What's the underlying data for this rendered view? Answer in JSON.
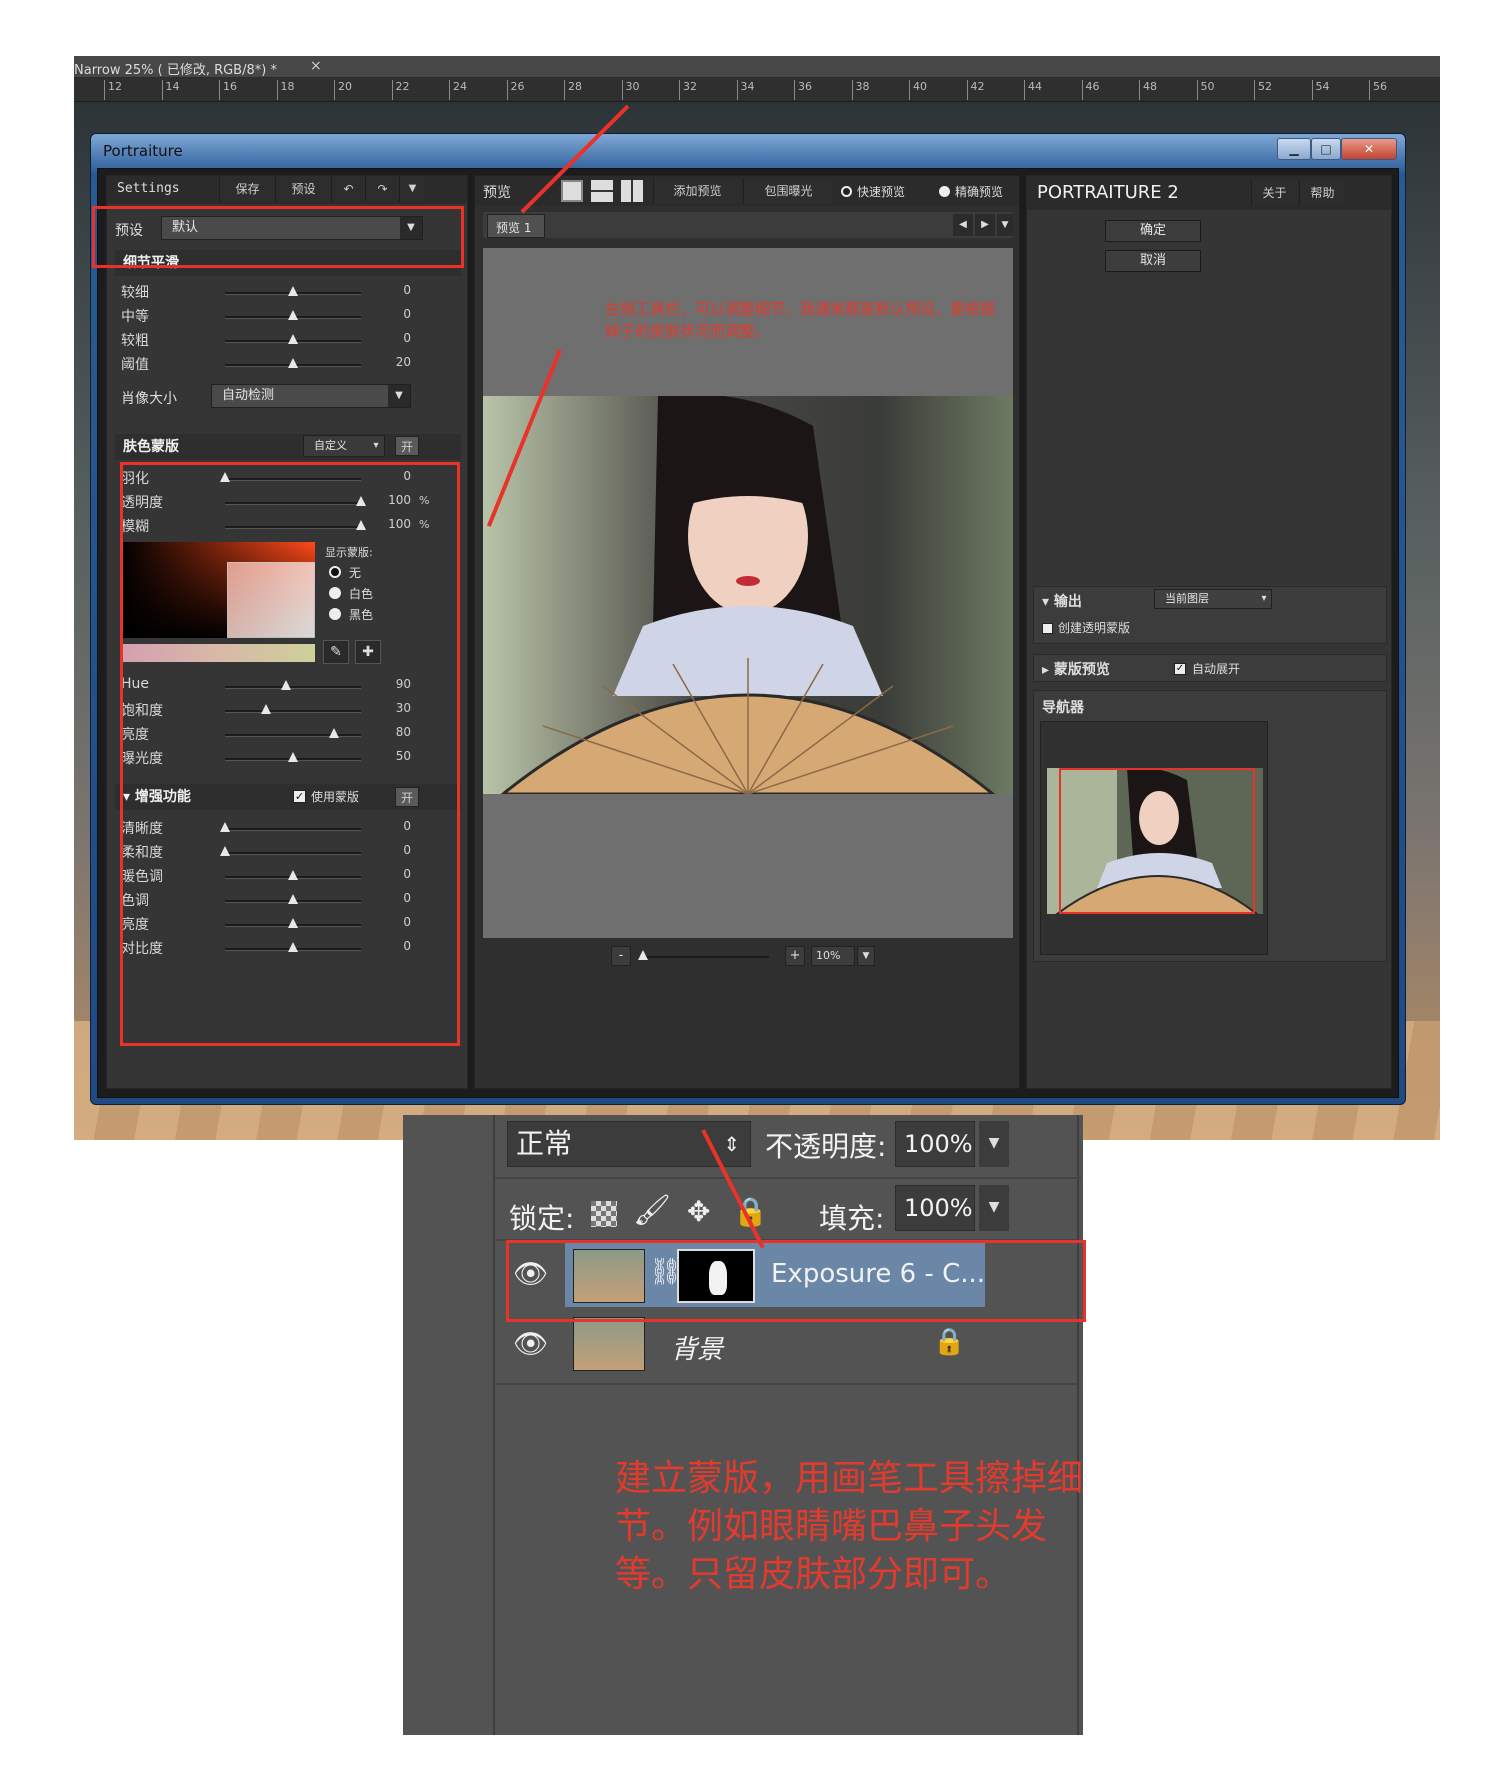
{
  "ps": {
    "tab_title": "Narrow  25%  ( 已修改, RGB/8*) *",
    "tab_close": "×",
    "ruler_ticks": [
      "12",
      "14",
      "16",
      "18",
      "20",
      "22",
      "24",
      "26",
      "28",
      "30",
      "32",
      "34",
      "36",
      "38",
      "40",
      "42",
      "44",
      "46",
      "48",
      "50",
      "52",
      "54",
      "56"
    ]
  },
  "window": {
    "title": "Portraiture",
    "min": "▁",
    "max": "□",
    "close": "✕"
  },
  "left": {
    "settings_title": "Settings",
    "save": "保存",
    "preset_btn": "预设",
    "undo": "↶",
    "redo": "↷",
    "menu": "▼",
    "preset_label": "预设",
    "preset_value": "默认",
    "detail_header": "细节平滑",
    "detail_rows": [
      {
        "label": "较细",
        "value": "0",
        "pos": 0.5
      },
      {
        "label": "中等",
        "value": "0",
        "pos": 0.5
      },
      {
        "label": "较粗",
        "value": "0",
        "pos": 0.5
      },
      {
        "label": "阈值",
        "value": "20",
        "pos": 0.5
      }
    ],
    "portrait_size_label": "肖像大小",
    "portrait_size_value": "自动检测",
    "skin_header": "肤色蒙版",
    "skin_mode": "自定义",
    "skin_toggle": "开",
    "skin_rows": [
      {
        "label": "羽化",
        "value": "0",
        "pos": 0.0,
        "unit": ""
      },
      {
        "label": "透明度",
        "value": "100",
        "pos": 1.0,
        "unit": "%"
      },
      {
        "label": "模糊",
        "value": "100",
        "pos": 1.0,
        "unit": "%"
      }
    ],
    "show_mask_label": "显示蒙版:",
    "mask_options": [
      "无",
      "白色",
      "黑色"
    ],
    "color_rows": [
      {
        "label": "Hue",
        "value": "90",
        "pos": 0.45
      },
      {
        "label": "饱和度",
        "value": "30",
        "pos": 0.3
      },
      {
        "label": "亮度",
        "value": "80",
        "pos": 0.8
      },
      {
        "label": "曝光度",
        "value": "50",
        "pos": 0.5
      }
    ],
    "enh_header": "增强功能",
    "enh_use_mask": "使用蒙版",
    "enh_toggle": "开",
    "enh_rows": [
      {
        "label": "清晰度",
        "value": "0",
        "pos": 0.0
      },
      {
        "label": "柔和度",
        "value": "0",
        "pos": 0.0
      },
      {
        "label": "暖色调",
        "value": "0",
        "pos": 0.5
      },
      {
        "label": "色调",
        "value": "0",
        "pos": 0.5
      },
      {
        "label": "亮度",
        "value": "0",
        "pos": 0.5
      },
      {
        "label": "对比度",
        "value": "0",
        "pos": 0.5
      }
    ]
  },
  "center": {
    "preview_title": "预览",
    "add_preview": "添加预览",
    "clip_exposure": "包围曝光",
    "fast_preview": "快速预览",
    "precise_preview": "精确预览",
    "tab": "预览 1",
    "annotation": "左侧工具栏，可以调整细节，我通常都是默认预设，要根据妹子的皮肤状况而调整。",
    "zoom_minus": "-",
    "zoom_plus": "+",
    "zoom_value": "10%"
  },
  "right": {
    "brand": "PORTRAITURE 2",
    "about": "关于",
    "help": "帮助",
    "ok": "确定",
    "cancel": "取消",
    "output_label": "输出",
    "output_value": "当前图层",
    "create_mask": "创建透明蒙版",
    "mask_preview": "蒙版预览",
    "auto_expand": "自动展开",
    "navigator": "导航器"
  },
  "layers": {
    "blend_mode": "正常",
    "opacity_label": "不透明度:",
    "opacity_value": "100%",
    "lock_label": "锁定:",
    "fill_label": "填充:",
    "fill_value": "100%",
    "layer1_name": "Exposure 6 - C...",
    "layer2_name": "背景"
  },
  "note": "建立蒙版，用画笔工具擦掉细节。例如眼睛嘴巴鼻子头发等。只留皮肤部分即可。",
  "colors": {
    "accent_red": "#e8322a",
    "panel": "#353535",
    "title_blue": "#3f6ea8"
  }
}
